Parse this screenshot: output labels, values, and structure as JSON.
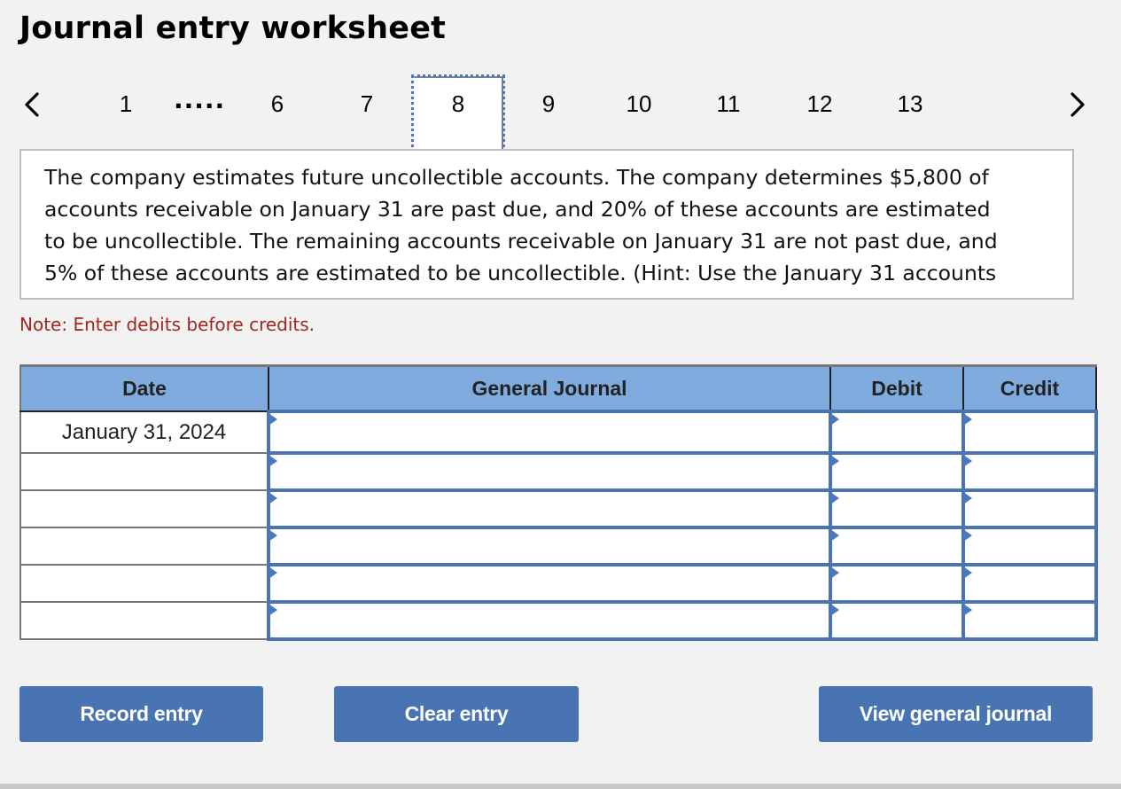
{
  "title": "Journal entry worksheet",
  "pager": {
    "prev_icon": "chevron-left-icon",
    "next_icon": "chevron-right-icon",
    "first_page": "1",
    "ellipsis": ".....",
    "pages": [
      "6",
      "7",
      "8",
      "9",
      "10",
      "11",
      "12",
      "13"
    ],
    "active_page": "8"
  },
  "question": {
    "text": "The company estimates future uncollectible accounts. The company determines $5,800 of accounts receivable on January 31 are past due, and 20% of these accounts are estimated to be uncollectible. The remaining accounts receivable on January 31 are not past due, and 5% of these accounts are estimated to be uncollectible. (Hint: Use the January 31 accounts"
  },
  "note": "Note: Enter debits before credits.",
  "table": {
    "headers": {
      "date": "Date",
      "general_journal": "General Journal",
      "debit": "Debit",
      "credit": "Credit"
    },
    "rows": [
      {
        "date": "January 31, 2024",
        "account": "",
        "debit": "",
        "credit": ""
      },
      {
        "date": "",
        "account": "",
        "debit": "",
        "credit": ""
      },
      {
        "date": "",
        "account": "",
        "debit": "",
        "credit": ""
      },
      {
        "date": "",
        "account": "",
        "debit": "",
        "credit": ""
      },
      {
        "date": "",
        "account": "",
        "debit": "",
        "credit": ""
      },
      {
        "date": "",
        "account": "",
        "debit": "",
        "credit": ""
      }
    ]
  },
  "buttons": {
    "record": "Record entry",
    "clear": "Clear entry",
    "view": "View general journal"
  },
  "colors": {
    "header_bg": "#80abdf",
    "button_bg": "#4874b3",
    "input_border": "#4a74b0",
    "note_text": "#a3261f"
  }
}
